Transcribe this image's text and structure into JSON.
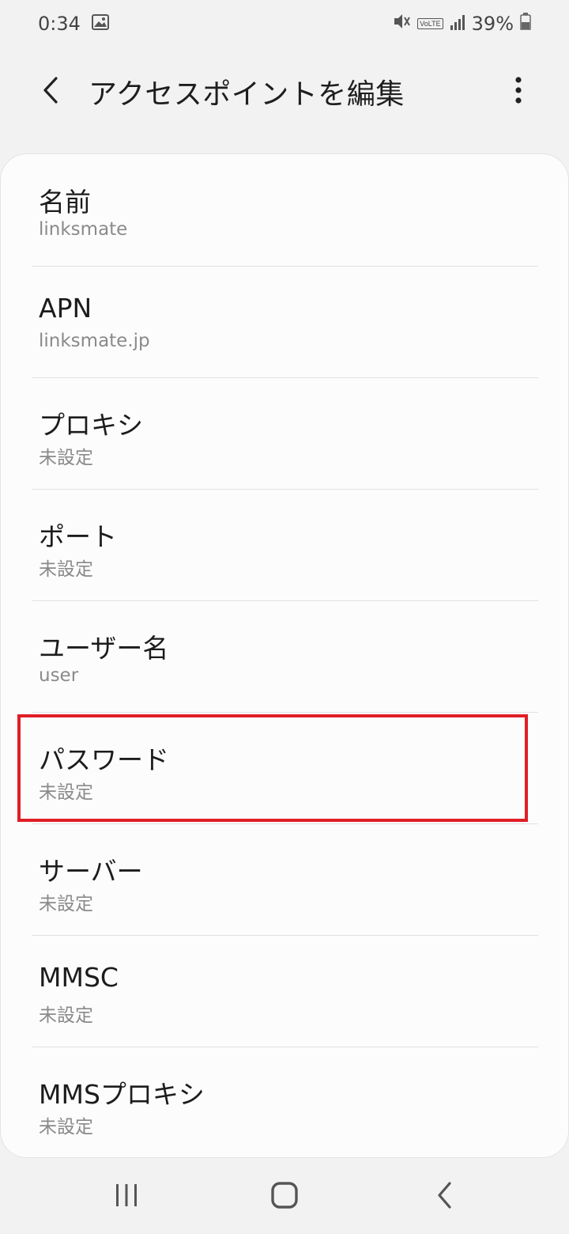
{
  "status_bar": {
    "time": "0:34",
    "battery": "39%",
    "volte_label": "VoLTE",
    "icons": [
      "gallery-icon",
      "mute-icon",
      "volte-icon",
      "signal-icon",
      "battery-icon"
    ]
  },
  "header": {
    "title": "アクセスポイントを編集",
    "back_icon": "chevron-left-icon",
    "more_icon": "more-vert-icon"
  },
  "settings": [
    {
      "label": "名前",
      "value": "linksmate"
    },
    {
      "label": "APN",
      "value": "linksmate.jp"
    },
    {
      "label": "プロキシ",
      "value": "未設定"
    },
    {
      "label": "ポート",
      "value": "未設定"
    },
    {
      "label": "ユーザー名",
      "value": "user"
    },
    {
      "label": "パスワード",
      "value": "未設定"
    },
    {
      "label": "サーバー",
      "value": "未設定"
    },
    {
      "label": "MMSC",
      "value": "未設定"
    },
    {
      "label": "MMSプロキシ",
      "value": "未設定"
    }
  ],
  "highlight": {
    "target": "パスワード",
    "color": "#e01e26"
  },
  "nav_bar": {
    "icons": [
      "recent-apps-icon",
      "home-icon",
      "back-icon"
    ]
  },
  "colors": {
    "background": "#f2f2f2",
    "card": "#fcfcfc",
    "primary_text": "#1c1c1c",
    "secondary_text": "#8a8a8a"
  }
}
